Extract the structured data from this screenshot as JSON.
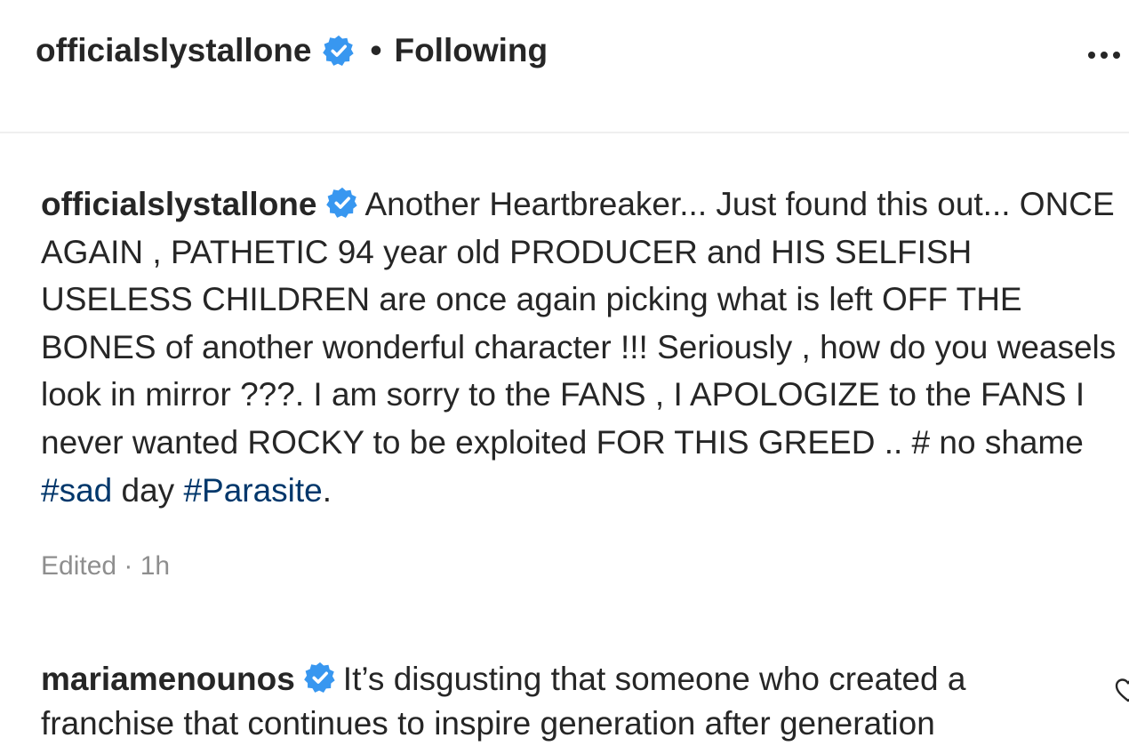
{
  "header": {
    "username": "officialslystallone",
    "separator": "•",
    "follow_status": "Following"
  },
  "caption": {
    "username": "officialslystallone",
    "text_intro": "Another Heartbreaker... Just found this out... ONCE AGAIN , PATHETIC 94 year old PRODUCER and HIS SELFISH USELESS CHILDREN are once again picking what is left OFF THE BONES of another wonderful character !!! Seriously , how do you weasels look in mirror ???. I am sorry to the FANS , I APOLOGIZE to the FANS I never wanted ROCKY to be exploited FOR THIS GREED .. # no shame ",
    "hashtag_1": "#sad",
    "text_mid": " day ",
    "hashtag_2": "#Parasite",
    "text_end": ".",
    "meta": "Edited · 1h"
  },
  "comment": {
    "username": "mariamenounos",
    "text": "It’s disgusting that someone who created a franchise that continues to inspire generation after generation"
  },
  "colors": {
    "text": "#262626",
    "secondary_text": "#8e8e8e",
    "hashtag": "#00376b",
    "verified_badge": "#3897f0",
    "divider": "#efefef"
  },
  "icons": [
    "verified-badge-icon",
    "more-options-icon",
    "heart-icon"
  ]
}
